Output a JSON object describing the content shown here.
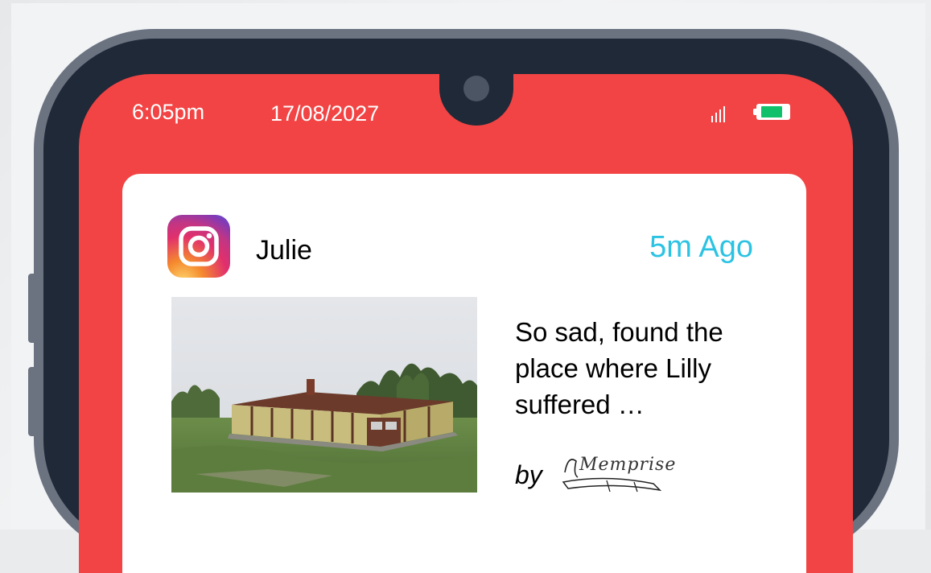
{
  "status_bar": {
    "time": "6:05pm",
    "date": "17/08/2027",
    "signal_icon": "signal-bars-icon",
    "battery_icon": "battery-icon",
    "battery_level": 0.8
  },
  "notification": {
    "app_icon": "instagram-icon",
    "sender": "Julie",
    "time_ago": "5m Ago",
    "message": "So sad, found the place where Lilly suffered …",
    "by_label": "by",
    "brand_logo_text": "Memprise"
  },
  "colors": {
    "screen_bg": "#f24444",
    "frame": "#1f2937",
    "bezel": "#6b7280",
    "time_ago": "#2cc3e3",
    "battery_fill": "#10c06a"
  }
}
